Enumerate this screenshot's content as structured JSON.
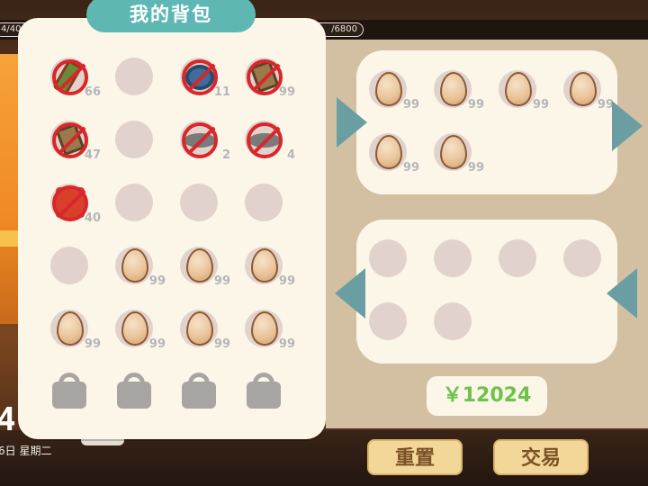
{
  "hud": {
    "stat_left": "4/400",
    "stat_right": "/6800",
    "clock": "4:",
    "date": "6日 星期二"
  },
  "bag": {
    "title": "我的背包",
    "rows": [
      [
        {
          "type": "item",
          "art": "skewer-icon",
          "qty": "66"
        },
        {
          "type": "empty"
        },
        {
          "type": "item",
          "art": "bowl-icon",
          "qty": "11"
        },
        {
          "type": "item",
          "art": "book-icon",
          "qty": "99"
        }
      ],
      [
        {
          "type": "item",
          "art": "book-icon",
          "qty": "47"
        },
        {
          "type": "empty"
        },
        {
          "type": "item",
          "art": "plate-icon",
          "qty": "2"
        },
        {
          "type": "item",
          "art": "plate-icon",
          "qty": "4"
        }
      ],
      [
        {
          "type": "item",
          "art": "box-icon",
          "qty": "40"
        },
        {
          "type": "empty"
        },
        {
          "type": "empty"
        },
        {
          "type": "empty"
        }
      ],
      [
        {
          "type": "empty"
        },
        {
          "type": "egg",
          "qty": "99"
        },
        {
          "type": "egg",
          "qty": "99"
        },
        {
          "type": "egg",
          "qty": "99"
        }
      ],
      [
        {
          "type": "egg",
          "qty": "99"
        },
        {
          "type": "egg",
          "qty": "99"
        },
        {
          "type": "egg",
          "qty": "99"
        },
        {
          "type": "egg",
          "qty": "99"
        }
      ],
      [
        {
          "type": "locked"
        },
        {
          "type": "locked"
        },
        {
          "type": "locked"
        },
        {
          "type": "locked"
        }
      ]
    ]
  },
  "offer": {
    "items": [
      {
        "type": "egg",
        "qty": "99"
      },
      {
        "type": "egg",
        "qty": "99"
      },
      {
        "type": "egg",
        "qty": "99"
      },
      {
        "type": "egg",
        "qty": "99"
      },
      {
        "type": "egg",
        "qty": "99"
      },
      {
        "type": "egg",
        "qty": "99"
      }
    ]
  },
  "receive": {
    "items": [
      {
        "type": "empty"
      },
      {
        "type": "empty"
      },
      {
        "type": "empty"
      },
      {
        "type": "empty"
      },
      {
        "type": "empty"
      },
      {
        "type": "empty"
      }
    ]
  },
  "money": "￥12024",
  "buttons": {
    "reset": "重置",
    "trade": "交易"
  },
  "colors": {
    "panel": "#fbf6e8",
    "title_bg": "#5fb7b4",
    "arrow": "#6b9ea2",
    "money": "#6cc24a",
    "button_bg": "#f3d798",
    "slot": "#e2d2cc",
    "forbidden": "#d9262a"
  }
}
